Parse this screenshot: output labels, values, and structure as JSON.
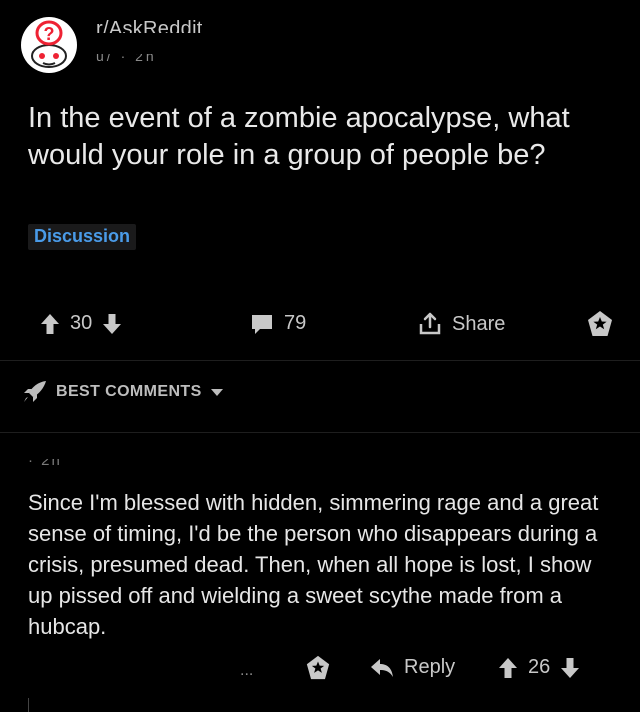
{
  "header": {
    "subreddit": "r/AskReddit",
    "post_meta": "u/ · 2h"
  },
  "post": {
    "title": "In the event of a zombie apocalypse, what would your role in a group of people be?",
    "flair": "Discussion",
    "upvotes": "30",
    "comments": "79",
    "share_label": "Share"
  },
  "sort": {
    "label": "BEST COMMENTS"
  },
  "comment": {
    "meta": "· 2h",
    "body": "Since I'm blessed with hidden, simmering rage and a great sense of timing, I'd be the person who disappears during a crisis, presumed dead. Then, when all hope is lost, I show up pissed off and wielding a sweet scythe made from a hubcap.",
    "more_label": "...",
    "reply_label": "Reply",
    "votes": "26"
  },
  "colors": {
    "background": "#000000",
    "flair_text": "#4a9be8",
    "text": "#e6e6e6"
  }
}
